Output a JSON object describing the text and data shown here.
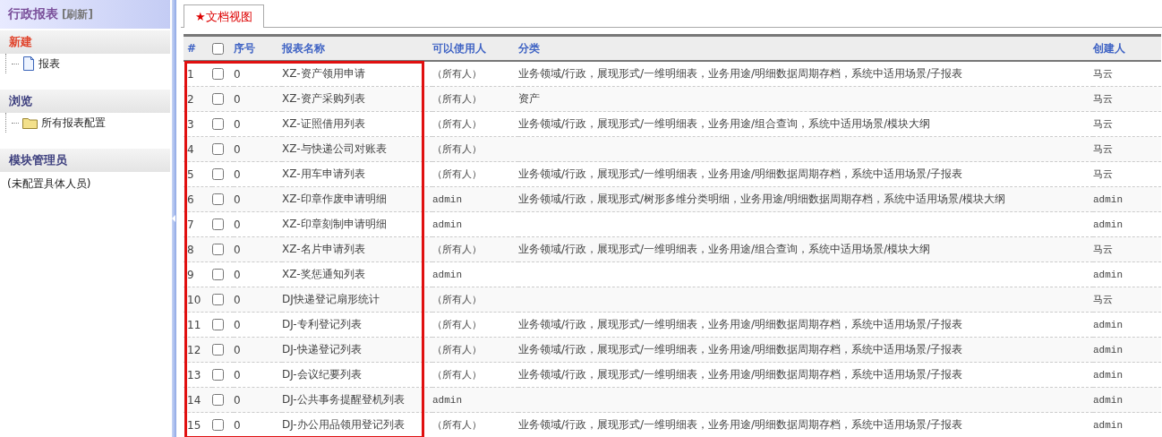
{
  "sidebar": {
    "title": "行政报表",
    "refresh": "[刷新]",
    "sections": [
      {
        "heading": "新建",
        "kind": "create",
        "items": [
          {
            "label": "报表"
          }
        ]
      },
      {
        "heading": "浏览",
        "kind": "browse",
        "items": [
          {
            "label": "所有报表配置"
          }
        ]
      },
      {
        "heading": "模块管理员",
        "kind": "admin",
        "note": "(未配置具体人员)"
      }
    ]
  },
  "tabs": [
    {
      "label": "★文档视图",
      "selected": true
    }
  ],
  "table": {
    "columns": [
      "#",
      "序号",
      "报表名称",
      "可以使用人",
      "分类",
      "创建人"
    ],
    "header_checked": false,
    "annotation": {
      "kind": "frame"
    },
    "rows": [
      {
        "num": "1",
        "checked": false,
        "seq": "0",
        "name": "XZ-资产领用申请",
        "user": "（所有人）",
        "category": "业务领域/行政，展现形式/一维明细表，业务用途/明细数据周期存档，系统中适用场景/子报表",
        "creator": "马云"
      },
      {
        "num": "2",
        "checked": false,
        "seq": "0",
        "name": "XZ-资产采购列表",
        "user": "（所有人）",
        "category": "资产",
        "creator": "马云"
      },
      {
        "num": "3",
        "checked": false,
        "seq": "0",
        "name": "XZ-证照借用列表",
        "user": "（所有人）",
        "category": "业务领域/行政，展现形式/一维明细表，业务用途/组合查询，系统中适用场景/模块大纲",
        "creator": "马云"
      },
      {
        "num": "4",
        "checked": false,
        "seq": "0",
        "name": "XZ-与快递公司对账表",
        "user": "（所有人）",
        "creator": "马云"
      },
      {
        "num": "5",
        "checked": false,
        "seq": "0",
        "name": "XZ-用车申请列表",
        "user": "（所有人）",
        "category": "业务领域/行政，展现形式/一维明细表，业务用途/明细数据周期存档，系统中适用场景/子报表",
        "creator": "马云"
      },
      {
        "num": "6",
        "checked": false,
        "seq": "0",
        "name": "XZ-印章作废申请明细",
        "user": "admin",
        "category": "业务领域/行政，展现形式/树形多维分类明细，业务用途/明细数据周期存档，系统中适用场景/模块大纲",
        "creator": "admin"
      },
      {
        "num": "7",
        "checked": false,
        "seq": "0",
        "name": "XZ-印章刻制申请明细",
        "user": "admin",
        "creator": "admin"
      },
      {
        "num": "8",
        "checked": false,
        "seq": "0",
        "name": "XZ-名片申请列表",
        "user": "（所有人）",
        "category": "业务领域/行政，展现形式/一维明细表，业务用途/组合查询，系统中适用场景/模块大纲",
        "creator": "马云"
      },
      {
        "num": "9",
        "checked": false,
        "seq": "0",
        "name": "XZ-奖惩通知列表",
        "user": "admin",
        "creator": "admin"
      },
      {
        "num": "10",
        "checked": false,
        "seq": "0",
        "name": "DJ快递登记扇形统计",
        "user": "（所有人）",
        "creator": "马云"
      },
      {
        "num": "11",
        "checked": false,
        "seq": "0",
        "name": "DJ-专利登记列表",
        "user": "（所有人）",
        "category": "业务领域/行政，展现形式/一维明细表，业务用途/明细数据周期存档，系统中适用场景/子报表",
        "creator": "admin"
      },
      {
        "num": "12",
        "checked": false,
        "seq": "0",
        "name": "DJ-快递登记列表",
        "user": "（所有人）",
        "category": "业务领域/行政，展现形式/一维明细表，业务用途/明细数据周期存档，系统中适用场景/子报表",
        "creator": "admin"
      },
      {
        "num": "13",
        "checked": false,
        "seq": "0",
        "name": "DJ-会议纪要列表",
        "user": "（所有人）",
        "category": "业务领域/行政，展现形式/一维明细表，业务用途/明细数据周期存档，系统中适用场景/子报表",
        "creator": "admin"
      },
      {
        "num": "14",
        "checked": false,
        "seq": "0",
        "name": "DJ-公共事务提醒登机列表",
        "user": "admin",
        "creator": "admin"
      },
      {
        "num": "15",
        "checked": false,
        "seq": "0",
        "name": "DJ-办公用品领用登记列表",
        "user": "（所有人）",
        "category": "业务领域/行政，展现形式/一维明细表，业务用途/明细数据周期存档，系统中适用场景/子报表",
        "creator": "admin"
      }
    ]
  }
}
